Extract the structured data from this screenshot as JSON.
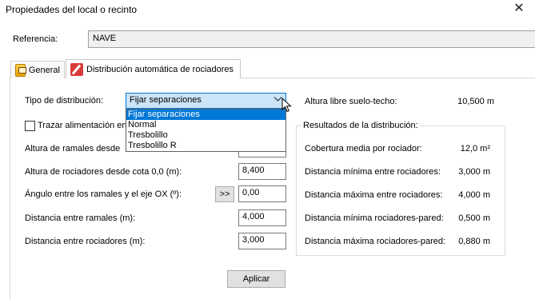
{
  "window": {
    "title": "Propiedades del local o recinto",
    "close_glyph": "✕"
  },
  "reference": {
    "label": "Referencia:",
    "value": "NAVE"
  },
  "tabs": [
    {
      "label": "General",
      "icon": "general-icon"
    },
    {
      "label": "Distribución automática de rociadores",
      "icon": "sprinkler-edit-icon"
    }
  ],
  "form": {
    "distribution_type": {
      "label": "Tipo de distribución:",
      "value": "Fijar separaciones",
      "options": [
        "Fijar separaciones",
        "Normal",
        "Tresbolillo",
        "Tresbolillo R"
      ],
      "selected_index": 0
    },
    "feed_checkbox": {
      "label": "Trazar alimentación en",
      "checked": false
    },
    "branch_height": {
      "label": "Altura de ramales desde"
    },
    "sprinkler_height": {
      "label": "Altura de rociadores desde cota 0,0 (m):",
      "value": "8,400"
    },
    "angle": {
      "label": "Ángulo entre los ramales y el eje OX (º):",
      "button": ">>",
      "value": "0,00"
    },
    "branch_distance": {
      "label": "Distancia entre ramales (m):",
      "value": "4,000"
    },
    "sprinkler_distance": {
      "label": "Distancia entre rociadores (m):",
      "value": "3,000"
    },
    "apply_button": "Aplicar"
  },
  "info": {
    "ceiling_height": {
      "label": "Altura libre suelo-techo:",
      "value": "10,500 m"
    },
    "results": {
      "title": "Resultados de la distribución:",
      "rows": [
        {
          "label": "Cobertura media por rociador:",
          "value": "12,0 m²"
        },
        {
          "label": "Distancia mínima entre rociadores:",
          "value": "3,000 m"
        },
        {
          "label": "Distancia máxima entre rociadores:",
          "value": "4,000 m"
        },
        {
          "label": "Distancia mínima rociadores-pared:",
          "value": "0,500 m"
        },
        {
          "label": "Distancia máxima rociadores-pared:",
          "value": "0,880 m"
        }
      ]
    }
  },
  "colors": {
    "selection": "#0078d7",
    "combo_bg": "#cce4f7",
    "button_bg": "#e1e1e1"
  }
}
